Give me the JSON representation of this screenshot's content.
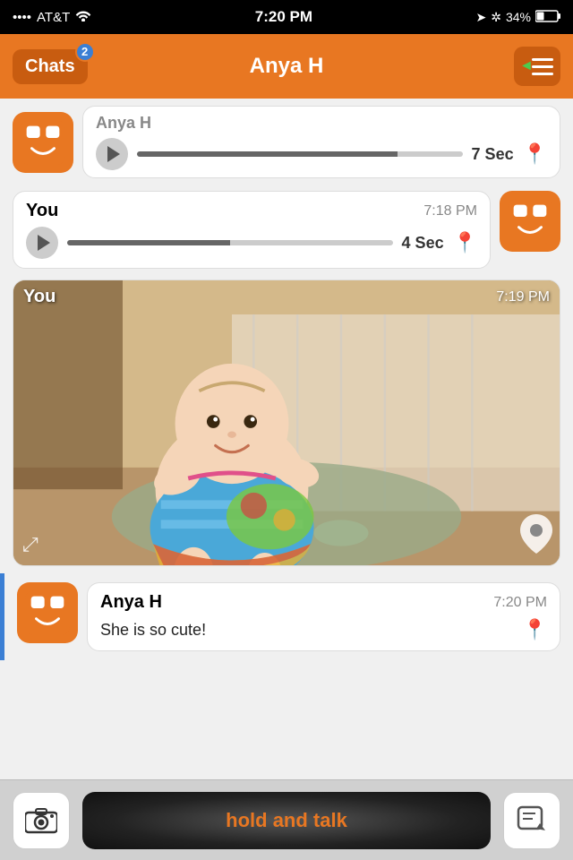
{
  "statusBar": {
    "carrier": "AT&T",
    "time": "7:20 PM",
    "battery": "34%"
  },
  "header": {
    "chatsLabel": "Chats",
    "badgeCount": "2",
    "title": "Anya H"
  },
  "messages": [
    {
      "id": "msg1",
      "type": "audio-partial",
      "sender": "Anya H",
      "time": "",
      "duration": "7 Sec"
    },
    {
      "id": "msg2",
      "type": "audio",
      "sender": "You",
      "time": "7:18 PM",
      "duration": "4 Sec",
      "side": "right"
    },
    {
      "id": "msg3",
      "type": "image",
      "sender": "You",
      "time": "7:19 PM",
      "side": "right"
    },
    {
      "id": "msg4",
      "type": "text",
      "sender": "Anya H",
      "time": "7:20 PM",
      "text": "She is so cute!",
      "side": "left"
    }
  ],
  "bottomBar": {
    "holdTalkLabel": "hold and talk"
  }
}
